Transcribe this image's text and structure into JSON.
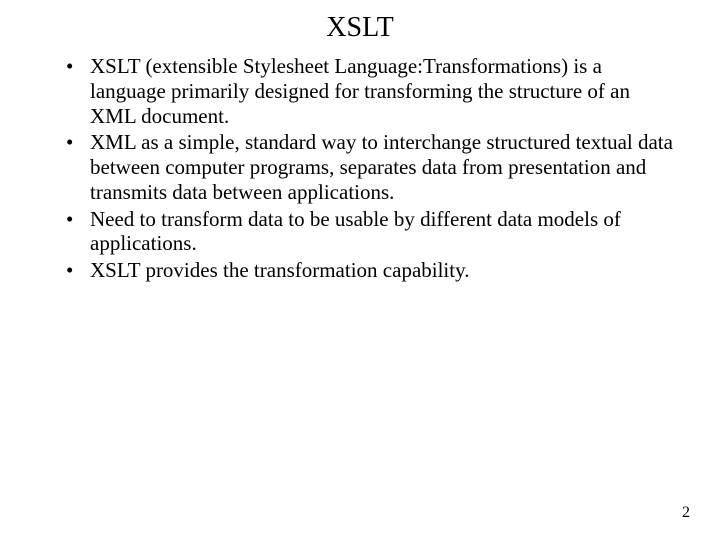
{
  "title": "XSLT",
  "bullets": [
    "XSLT (extensible Stylesheet Language:Transformations) is a language primarily designed for transforming the structure of an XML document.",
    "XML as a simple, standard way to interchange structured textual data between computer programs, separates data from presentation and transmits data between applications.",
    "Need to transform data to be usable by different data models of applications.",
    "XSLT provides the transformation capability."
  ],
  "page_number": "2"
}
